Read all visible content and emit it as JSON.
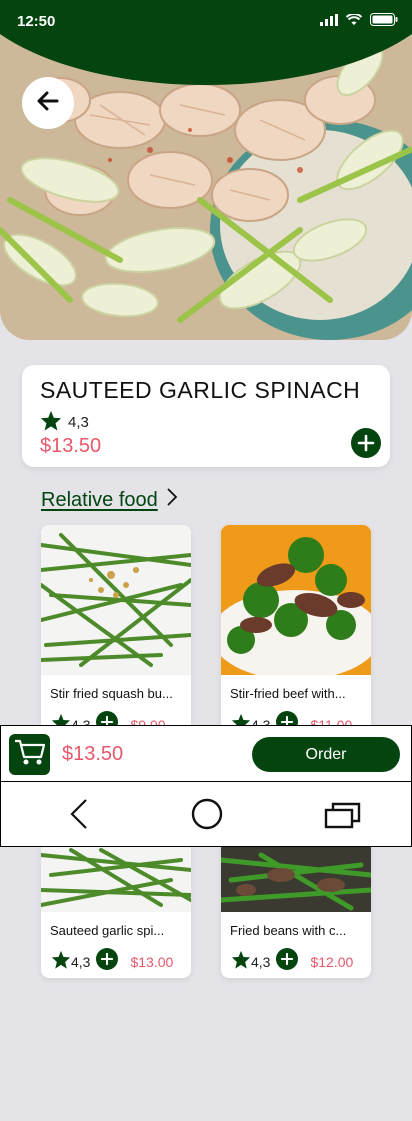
{
  "status_bar": {
    "time": "12:50"
  },
  "colors": {
    "brand": "#03440f",
    "price": "#e8586a",
    "background": "#e3e3e8"
  },
  "product": {
    "title": "SAUTEED GARLIC SPINACH",
    "rating": "4,3",
    "price": "$13.50"
  },
  "relative": {
    "label": "Relative food"
  },
  "foods": [
    {
      "name": "Stir fried squash bu...",
      "rating": "4,3",
      "price": "$9.00"
    },
    {
      "name": "Stir-fried beef with...",
      "rating": "4,3",
      "price": "$11.00"
    },
    {
      "name": "Sauteed garlic spi...",
      "rating": "4,3",
      "price": "$13.00"
    },
    {
      "name": "Fried beans with c...",
      "rating": "4,3",
      "price": "$12.00"
    }
  ],
  "order_bar": {
    "total": "$13.50",
    "order_label": "Order"
  },
  "icons": [
    "back-arrow-icon",
    "star-icon",
    "plus-icon",
    "chevron-right-icon",
    "cart-icon",
    "nav-back-icon",
    "nav-home-icon",
    "nav-recents-icon"
  ]
}
